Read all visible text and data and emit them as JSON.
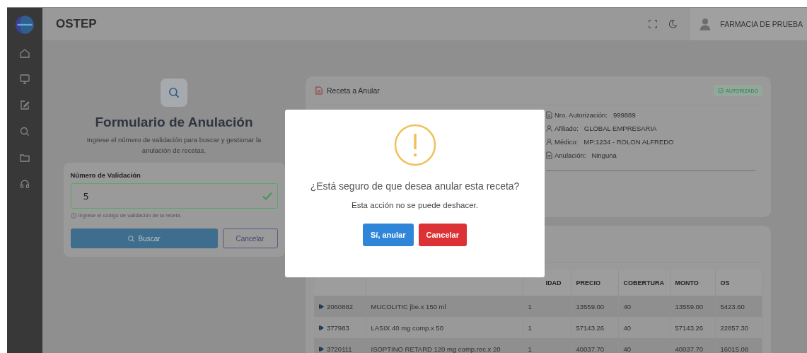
{
  "header": {
    "title": "OSTEP",
    "user": "FARMACIA DE PRUEBA"
  },
  "search_form": {
    "title": "Formulario de Anulación",
    "description": "Ingrese el número de validación para buscar y gestionar la anulación de recetas.",
    "field_label": "Número de Validación",
    "value": "5",
    "valid": true,
    "hint": "Ingrese el código de validación de la receta.",
    "buttons": [
      "Buscar",
      "Cancelar"
    ]
  },
  "receta": {
    "title": "Receta a Anular",
    "status": "AUTORIZADO",
    "details": [
      {
        "kind": "doc",
        "label": "Nro. Autorización:",
        "value": "999889"
      },
      {
        "kind": "person",
        "label": "Afiliado:",
        "value": "GLOBAL EMPRESARIA"
      },
      {
        "kind": "person",
        "label": "Médico:",
        "value": "MP:1234 - ROLON ALFREDO"
      },
      {
        "kind": "doc",
        "label": "Anulación:",
        "value": "Ninguna"
      }
    ]
  },
  "table": {
    "columns": [
      "",
      "",
      "IDAD",
      "PRECIO",
      "COBERTURA",
      "MONTO",
      "OS"
    ],
    "rows": [
      [
        "2060882",
        "MUCOLITIC jbe.x 150 ml",
        "1",
        "13559.00",
        "40",
        "13559.00",
        "5423.60"
      ],
      [
        "377983",
        "LASIX 40 mg comp.x 50",
        "1",
        "57143.26",
        "40",
        "57143.26",
        "22857.30"
      ],
      [
        "3720111",
        "ISOPTINO RETARD 120 mg comp.rec.x 20",
        "1",
        "40037.70",
        "40",
        "40037.70",
        "16015.08"
      ]
    ]
  },
  "modal": {
    "question": "¿Está seguro de que desea anular esta receta?",
    "message": "Esta acción no se puede deshacer.",
    "confirm": "Sí, anular",
    "cancel": "Cancelar"
  }
}
